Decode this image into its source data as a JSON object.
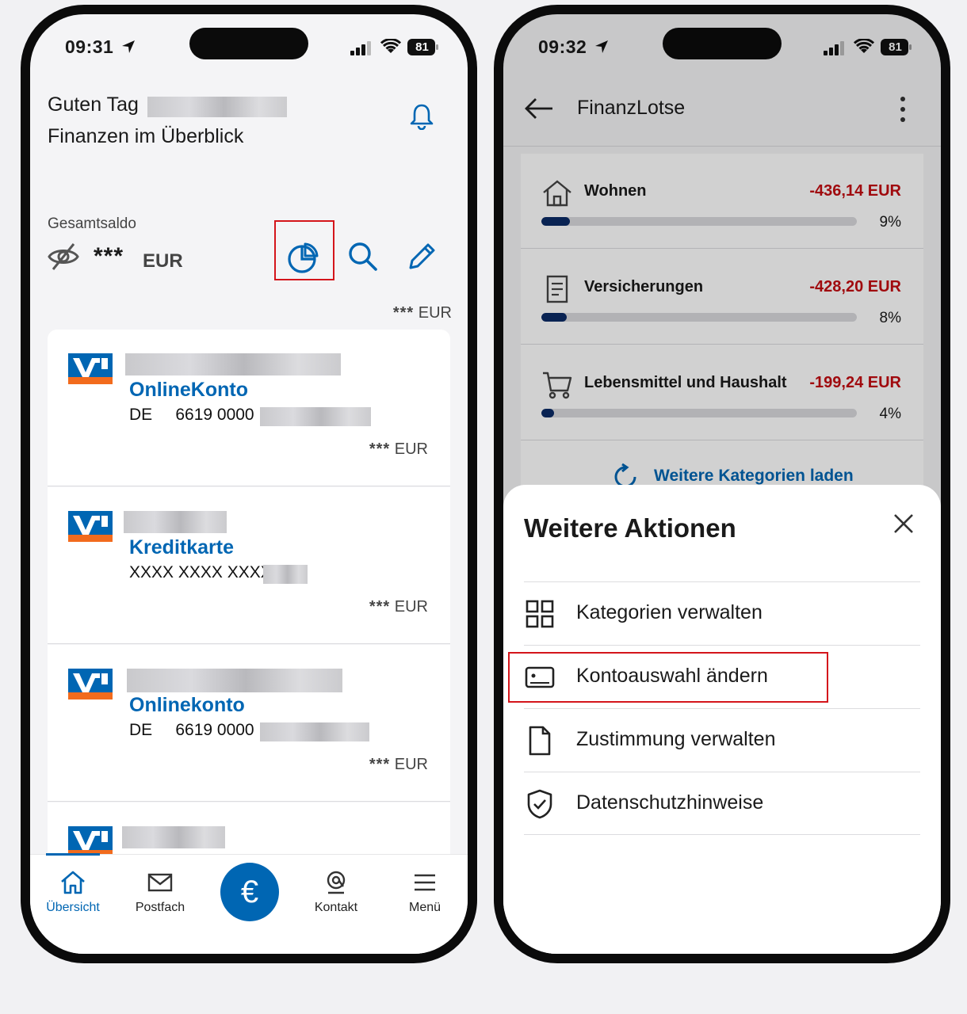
{
  "left": {
    "status": {
      "time": "09:31",
      "battery": "81"
    },
    "greeting_line1": "Guten Tag",
    "greeting_line2": "Finanzen im Überblick",
    "saldo_label": "Gesamtsaldo",
    "saldo_value": "***",
    "saldo_currency": "EUR",
    "total_value": "***",
    "total_currency": "EUR",
    "accounts": [
      {
        "name": "OnlineKonto",
        "sub": "DE     6619 0000",
        "balance": "***",
        "currency": "EUR"
      },
      {
        "name": "Kreditkarte",
        "sub": "XXXX XXXX XXXX",
        "balance": "***",
        "currency": "EUR"
      },
      {
        "name": "Onlinekonto",
        "sub": "DE     6619 0000",
        "balance": "***",
        "currency": "EUR"
      }
    ]
  },
  "right": {
    "status": {
      "time": "09:32",
      "battery": "81"
    },
    "title": "FinanzLotse",
    "categories": [
      {
        "name": "Wohnen",
        "amount": "-436,14 EUR",
        "percent_label": "9%",
        "percent": 9,
        "icon": "house-icon"
      },
      {
        "name": "Versicherungen",
        "amount": "-428,20 EUR",
        "percent_label": "8%",
        "percent": 8,
        "icon": "document-icon"
      },
      {
        "name": "Lebensmittel und Haushalt",
        "amount": "-199,24 EUR",
        "percent_label": "4%",
        "percent": 4,
        "icon": "cart-icon"
      }
    ],
    "reload_label": "Weitere Kategorien laden",
    "sheet": {
      "title": "Weitere Aktionen",
      "actions": [
        {
          "label": "Kategorien verwalten",
          "icon": "grid-icon"
        },
        {
          "label": "Kontoauswahl ändern",
          "icon": "account-card-icon"
        },
        {
          "label": "Zustimmung verwalten",
          "icon": "file-icon"
        },
        {
          "label": "Datenschutzhinweise",
          "icon": "shield-check-icon"
        }
      ]
    }
  },
  "nav": {
    "items": [
      {
        "label": "Übersicht",
        "icon": "home-icon",
        "active": true
      },
      {
        "label": "Postfach",
        "icon": "mail-icon"
      },
      {
        "label": "€",
        "icon": "euro-icon"
      },
      {
        "label": "Kontakt",
        "icon": "contact-icon"
      },
      {
        "label": "Menü",
        "icon": "menu-icon"
      }
    ]
  },
  "colors": {
    "brand_blue": "#0066b3",
    "negative_red": "#c40d12",
    "highlight_red": "#d4151b",
    "vr_orange": "#f26b1d"
  }
}
